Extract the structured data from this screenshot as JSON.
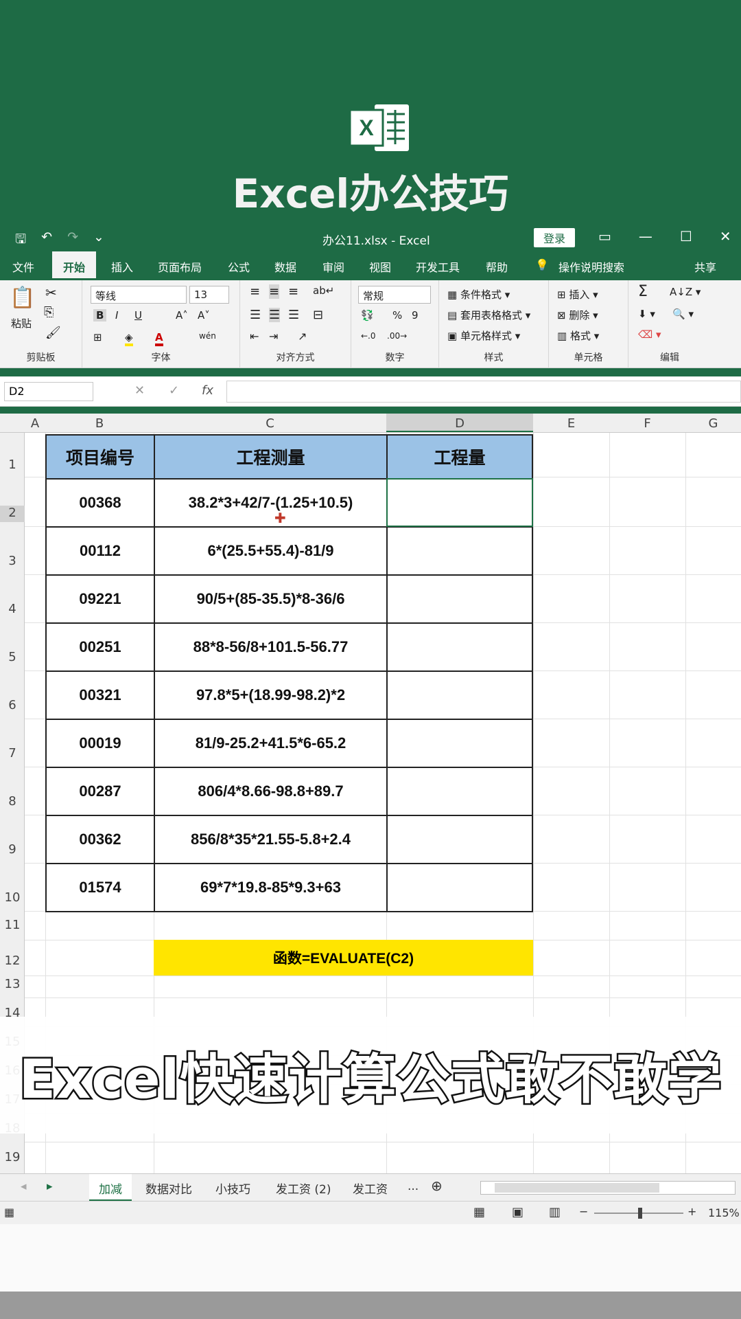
{
  "banner": {
    "title": "Excel办公技巧",
    "logo_letter": "X"
  },
  "titlebar": {
    "filename": "办公11.xlsx  -  Excel",
    "login": "登录",
    "minimize": "—",
    "maximize": "☐",
    "close": "✕",
    "save_icon": "🖫",
    "undo_icon": "↶",
    "redo_icon": "↷",
    "customize_icon": "⌄"
  },
  "tabs": {
    "file": "文件",
    "home": "开始",
    "insert": "插入",
    "page_layout": "页面布局",
    "formulas": "公式",
    "data": "数据",
    "review": "审阅",
    "view": "视图",
    "developer": "开发工具",
    "help": "帮助",
    "tell_me": "操作说明搜索",
    "share": "共享"
  },
  "ribbon": {
    "paste": "粘贴",
    "clipboard": "剪贴板",
    "font_name": "等线",
    "font_size": "13",
    "bold": "B",
    "italic": "I",
    "underline": "U",
    "grow": "A˄",
    "shrink": "A˅",
    "font_group": "字体",
    "align_group": "对齐方式",
    "number_format": "常规",
    "percent": "%",
    "comma": "9",
    "number_group": "数字",
    "cond_format": "条件格式",
    "table_format": "套用表格格式",
    "cell_style": "单元格样式",
    "styles_group": "样式",
    "insert": "插入",
    "delete": "删除",
    "format": "格式",
    "cells_group": "单元格",
    "sum": "Σ",
    "editing_group": "编辑"
  },
  "formula_bar": {
    "name_box": "D2",
    "cancel": "✕",
    "enter": "✓",
    "fx": "fx",
    "content": ""
  },
  "columns": [
    "A",
    "B",
    "C",
    "D",
    "E",
    "F",
    "G"
  ],
  "rows": [
    "1",
    "2",
    "3",
    "4",
    "5",
    "6",
    "7",
    "8",
    "9",
    "10",
    "11",
    "12",
    "13",
    "14",
    "15",
    "16",
    "17",
    "18",
    "19"
  ],
  "table": {
    "headers": [
      "项目编号",
      "工程测量",
      "工程量"
    ],
    "rows": [
      [
        "00368",
        "38.2*3+42/7-(1.25+10.5)",
        ""
      ],
      [
        "00112",
        "6*(25.5+55.4)-81/9",
        ""
      ],
      [
        "09221",
        "90/5+(85-35.5)*8-36/6",
        ""
      ],
      [
        "00251",
        "88*8-56/8+101.5-56.77",
        ""
      ],
      [
        "00321",
        "97.8*5+(18.99-98.2)*2",
        ""
      ],
      [
        "00019",
        "81/9-25.2+41.5*6-65.2",
        ""
      ],
      [
        "00287",
        "806/4*8.66-98.8+89.7",
        ""
      ],
      [
        "00362",
        "856/8*35*21.55-5.8+2.4",
        ""
      ],
      [
        "01574",
        "69*7*19.8-85*9.3+63",
        ""
      ]
    ]
  },
  "formula_note": "函数=EVALUATE(C2)",
  "caption": "Excel快速计算公式敢不敢学",
  "sheet_tabs": [
    "加减",
    "数据对比",
    "小技巧",
    "发工资 (2)",
    "发工资",
    "..."
  ],
  "status": {
    "zoom": "115%"
  }
}
